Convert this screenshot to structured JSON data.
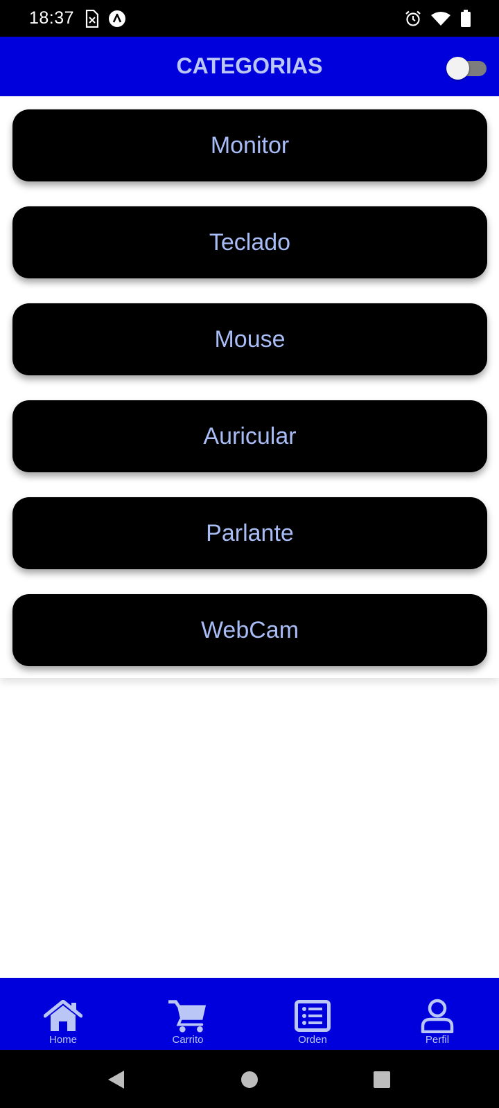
{
  "status_bar": {
    "time": "18:37",
    "left_icons": [
      "sim-card-icon",
      "app-notification-icon"
    ],
    "right_icons": [
      "alarm-icon",
      "wifi-icon",
      "battery-icon"
    ]
  },
  "header": {
    "title": "CATEGORIAS",
    "toggle_on": false
  },
  "categories": [
    {
      "label": "Monitor"
    },
    {
      "label": "Teclado"
    },
    {
      "label": "Mouse"
    },
    {
      "label": "Auricular"
    },
    {
      "label": "Parlante"
    },
    {
      "label": "WebCam"
    }
  ],
  "bottom_nav": {
    "items": [
      {
        "label": "Home",
        "icon": "home-icon"
      },
      {
        "label": "Carrito",
        "icon": "cart-icon"
      },
      {
        "label": "Orden",
        "icon": "list-icon"
      },
      {
        "label": "Perfil",
        "icon": "profile-icon"
      }
    ]
  },
  "colors": {
    "accent": "#0000dd",
    "text_light": "#b9c6f6",
    "card": "#000000"
  }
}
